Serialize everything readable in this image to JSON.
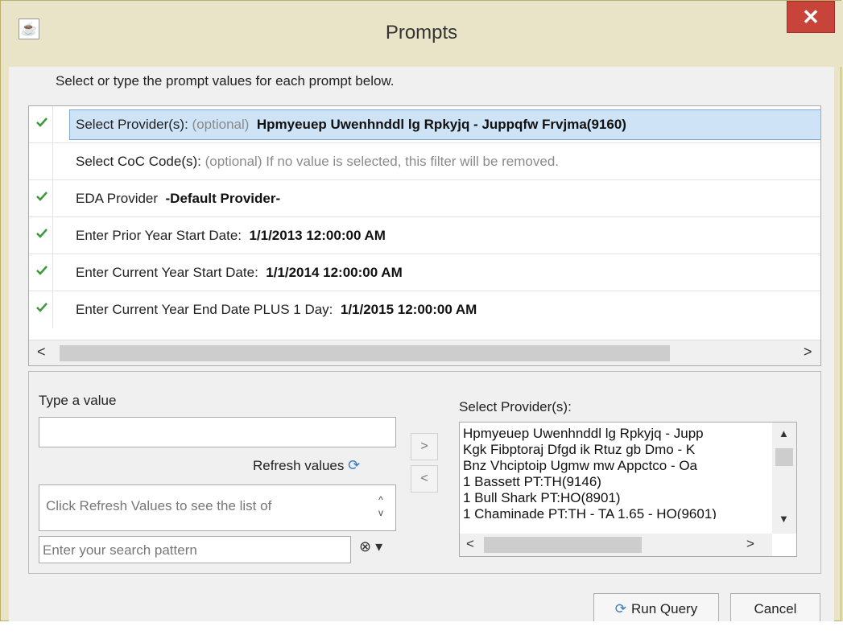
{
  "window": {
    "title": "Prompts",
    "close_label": "✕"
  },
  "instructions": "Select or type the prompt values for each prompt below.",
  "prompts": [
    {
      "label": "Select Provider(s): ",
      "optional": "(optional)",
      "value": "Hpmyeuep Uwenhnddl lg Rpkyjq - Juppqfw Frvjma(9160)",
      "checked": true
    },
    {
      "label": "Select CoC Code(s): ",
      "optional": "(optional) If no value is selected, this filter will be removed.",
      "value": "",
      "checked": false
    },
    {
      "label": "EDA Provider ",
      "optional": "",
      "value": "-Default Provider-",
      "checked": true
    },
    {
      "label": "Enter Prior Year Start Date: ",
      "optional": "",
      "value": "1/1/2013 12:00:00 AM",
      "checked": true
    },
    {
      "label": "Enter Current Year Start Date: ",
      "optional": "",
      "value": "1/1/2014 12:00:00 AM",
      "checked": true
    },
    {
      "label": "Enter Current Year End Date PLUS 1 Day: ",
      "optional": "",
      "value": "1/1/2015 12:00:00 AM",
      "checked": true
    }
  ],
  "value_panel": {
    "type_label": "Type a value",
    "refresh_label": "Refresh values",
    "list_placeholder": "Click Refresh Values to see the list of",
    "search_placeholder": "Enter your search pattern"
  },
  "selected_panel": {
    "label": "Select Provider(s):",
    "items": [
      "Hpmyeuep Uwenhnddl lg Rpkyjq - Jupp",
      "Kgk Fibptoraj Dfgd ik Rtuz gb Dmo - K",
      "Bnz Vhciptoip Ugmw mw Appctco - Oa",
      "1 Bassett  PT:TH(9146)",
      "1 Bull Shark  PT:HO(8901)",
      "1 Chaminade  PT:TH - TA 1.65 - HO(9601)"
    ]
  },
  "buttons": {
    "run_query": "Run Query",
    "cancel": "Cancel",
    "move_right": ">",
    "move_left": "<"
  },
  "colors": {
    "title_bg": "#e9e4c7",
    "close_bg": "#c8443b",
    "selection_bg": "#cfe3f7",
    "check_green": "#3c9a3c"
  }
}
